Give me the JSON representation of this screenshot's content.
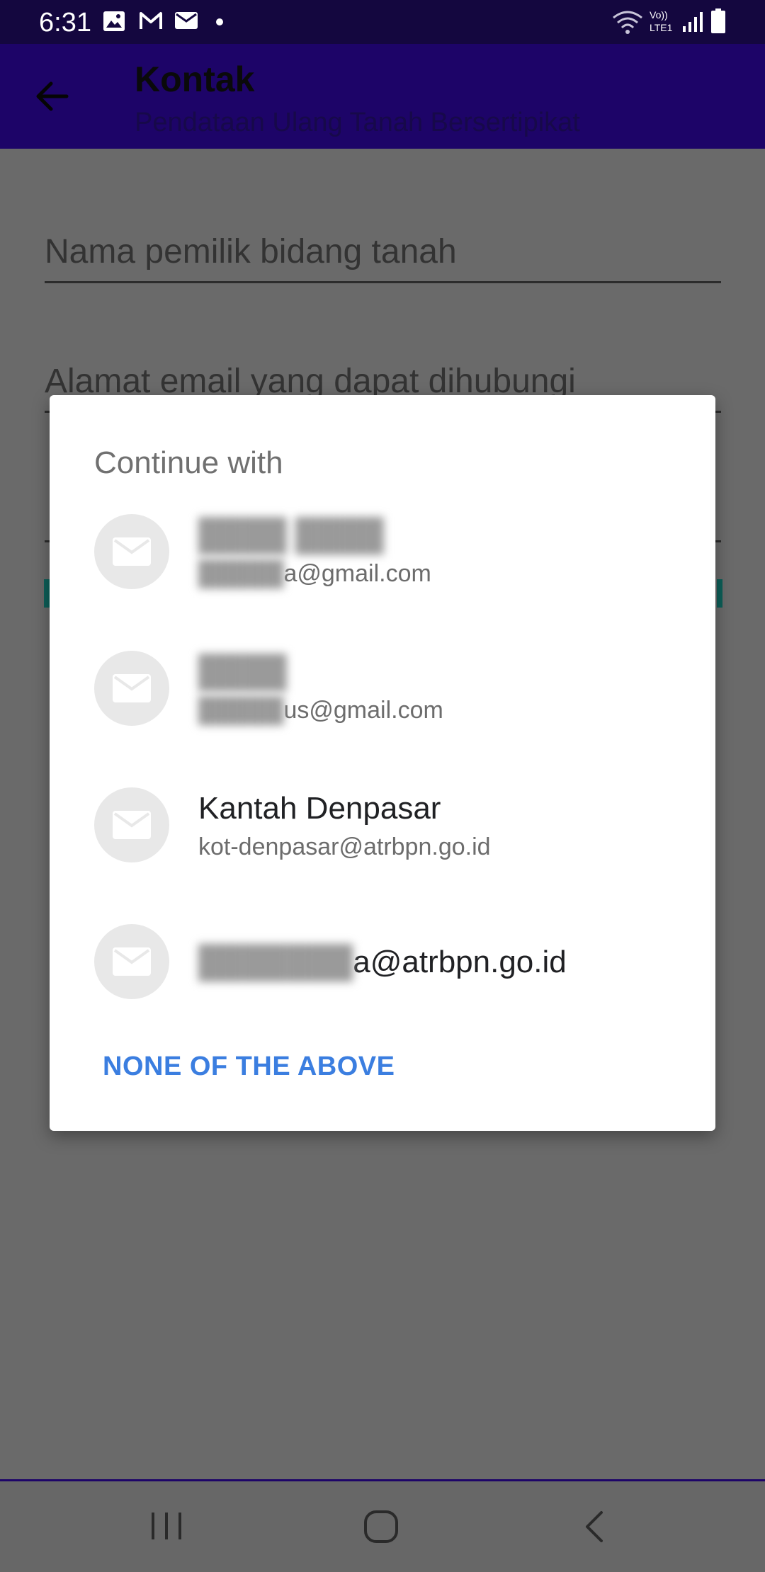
{
  "status_bar": {
    "time": "6:31",
    "volte_label": "Vo))\nLTE1",
    "icons": [
      "gallery-icon",
      "gmail-icon",
      "mail-icon",
      "dot-icon",
      "wifi-icon",
      "volte-icon",
      "signal-icon",
      "battery-icon"
    ]
  },
  "app_bar": {
    "title": "Kontak",
    "subtitle": "Pendataan Ulang Tanah Bersertipikat"
  },
  "form": {
    "field1_placeholder": "Nama pemilik bidang tanah",
    "field2_placeholder": "Alamat email yang dapat dihubungi"
  },
  "dialog": {
    "title": "Continue with",
    "accounts": [
      {
        "name": "",
        "email": "a@gmail.com",
        "email_prefix_blurred": true
      },
      {
        "name": "",
        "email": "us@gmail.com",
        "email_prefix_blurred": true
      },
      {
        "name": "Kantah Denpasar",
        "email": "kot-denpasar@atrbpn.go.id"
      },
      {
        "email": "a@atrbpn.go.id",
        "email_prefix_blurred": true
      }
    ],
    "none_button": "NONE OF THE ABOVE"
  },
  "colors": {
    "status_bar": "#14073f",
    "app_bar": "#1d0468",
    "scrim": "#6a6a6a",
    "accent_button": "#3b7ee0",
    "teal_link": "#0d5f58"
  }
}
